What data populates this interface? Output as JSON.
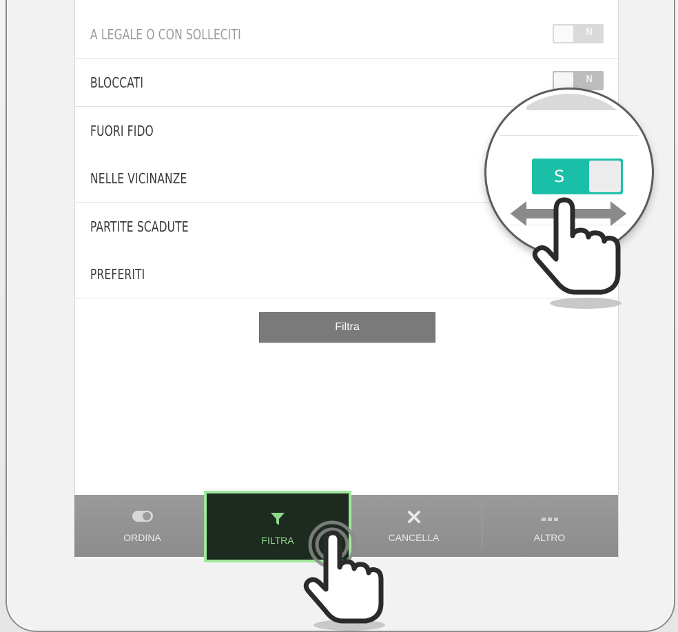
{
  "filters": {
    "rows": [
      {
        "label": "A LEGALE O CON SOLLECITI",
        "toggle": "N"
      },
      {
        "label": "BLOCCATI",
        "toggle": "N"
      },
      {
        "label": "FUORI FIDO",
        "toggle": ""
      },
      {
        "label": "NELLE VICINANZE",
        "toggle": ""
      },
      {
        "label": "PARTITE SCADUTE",
        "toggle": ""
      },
      {
        "label": "PREFERITI",
        "toggle": ""
      }
    ],
    "apply_button": "Filtra"
  },
  "magnifier": {
    "toggle_label": "S",
    "toggle_color": "#1bbfa7"
  },
  "bottom_bar": {
    "tabs": [
      {
        "label": "ORDINA",
        "icon": "toggle-icon"
      },
      {
        "label": "FILTRA",
        "icon": "funnel-icon",
        "active": true
      },
      {
        "label": "CANCELLA",
        "icon": "close-icon"
      },
      {
        "label": "ALTRO",
        "icon": "more-icon"
      }
    ],
    "active_color": "#9ee89a"
  }
}
